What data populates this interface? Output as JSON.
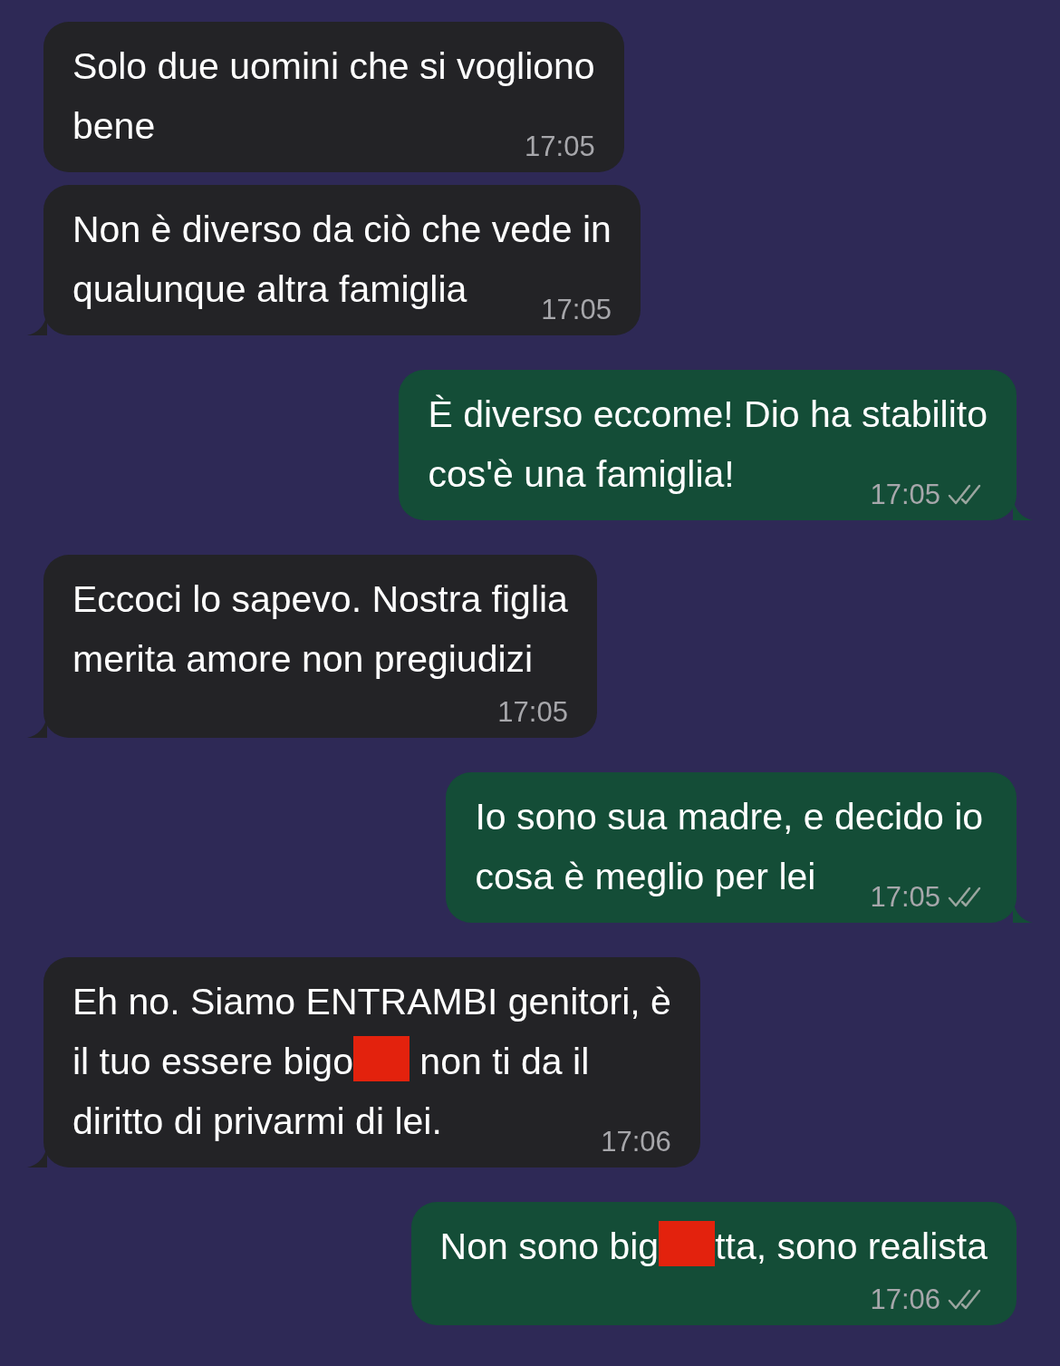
{
  "messages": [
    {
      "kind": "incoming",
      "tail": false,
      "time_on_own_line": false,
      "time": "17:05",
      "lines": [
        [
          {
            "kind": "text",
            "text": "Solo due uomini che si vogliono"
          }
        ],
        [
          {
            "kind": "text",
            "text": "bene"
          }
        ]
      ]
    },
    {
      "kind": "incoming",
      "tail": true,
      "time_on_own_line": false,
      "time": "17:05",
      "lines": [
        [
          {
            "kind": "text",
            "text": "Non è diverso da ciò che vede in"
          }
        ],
        [
          {
            "kind": "text",
            "text": "qualunque altra famiglia"
          }
        ]
      ]
    },
    {
      "kind": "outgoing",
      "tail": true,
      "time_on_own_line": false,
      "time": "17:05",
      "delivered": true,
      "lines": [
        [
          {
            "kind": "text",
            "text": "È diverso eccome! Dio ha stabilito"
          }
        ],
        [
          {
            "kind": "text",
            "text": "cos'è una famiglia!"
          }
        ]
      ]
    },
    {
      "kind": "incoming",
      "tail": true,
      "time_on_own_line": true,
      "time": "17:05",
      "lines": [
        [
          {
            "kind": "text",
            "text": "Eccoci lo sapevo. Nostra figlia"
          }
        ],
        [
          {
            "kind": "text",
            "text": "merita amore non pregiudizi"
          }
        ]
      ]
    },
    {
      "kind": "outgoing",
      "tail": true,
      "time_on_own_line": false,
      "time": "17:05",
      "delivered": true,
      "lines": [
        [
          {
            "kind": "text",
            "text": "Io sono sua madre, e decido io"
          }
        ],
        [
          {
            "kind": "text",
            "text": "cosa è meglio per lei"
          }
        ]
      ]
    },
    {
      "kind": "incoming",
      "tail": true,
      "time_on_own_line": false,
      "time": "17:06",
      "lines": [
        [
          {
            "kind": "text",
            "text": "Eh no. Siamo ENTRAMBI genitori, è"
          }
        ],
        [
          {
            "kind": "text",
            "text": "il tuo essere bigo"
          },
          {
            "kind": "redaction"
          },
          {
            "kind": "text",
            "text": " non ti da il"
          }
        ],
        [
          {
            "kind": "text",
            "text": "diritto di privarmi di lei."
          }
        ]
      ]
    },
    {
      "kind": "outgoing",
      "tail": false,
      "time_on_own_line": true,
      "time": "17:06",
      "delivered": true,
      "lines": [
        [
          {
            "kind": "text",
            "text": "Non sono big"
          },
          {
            "kind": "redaction"
          },
          {
            "kind": "text",
            "text": "tta, sono realista"
          }
        ]
      ]
    }
  ]
}
